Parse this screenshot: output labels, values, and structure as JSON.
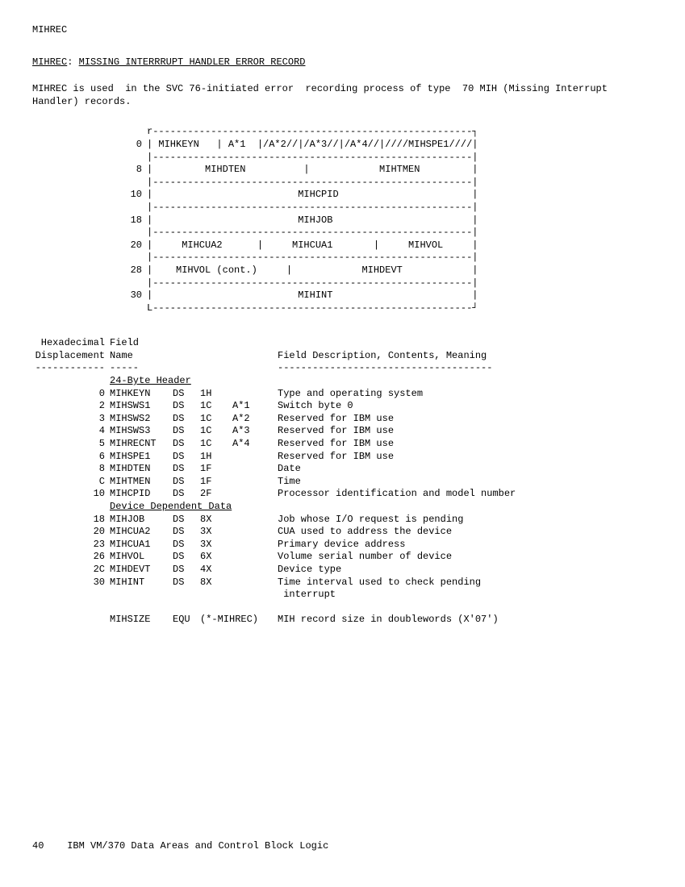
{
  "header_name": "MIHREC",
  "section_title_prefix": "MIHREC",
  "section_title_text": "MISSING INTERRRUPT HANDLER ERROR RECORD",
  "intro": "MIHREC is used  in the SVC 76-initiated error  recording process of type  70 MIH (Missing Interrupt Handler) records.",
  "layout": {
    "rows": [
      {
        "off": "0",
        "line": "| MIHKEYN   | A*1  |/A*2//|/A*3//|/A*4//|////MIHSPE1////|"
      },
      {
        "off": "",
        "line": "|-------------------------------------------------------|"
      },
      {
        "off": "8",
        "line": "|         MIHDTEN          |            MIHTMEN         |"
      },
      {
        "off": "",
        "line": "|-------------------------------------------------------|"
      },
      {
        "off": "10",
        "line": "|                         MIHCPID                       |"
      },
      {
        "off": "",
        "line": "|-------------------------------------------------------|"
      },
      {
        "off": "18",
        "line": "|                         MIHJOB                        |"
      },
      {
        "off": "",
        "line": "|-------------------------------------------------------|"
      },
      {
        "off": "20",
        "line": "|     MIHCUA2      |     MIHCUA1       |     MIHVOL     |"
      },
      {
        "off": "",
        "line": "|-------------------------------------------------------|"
      },
      {
        "off": "28",
        "line": "|    MIHVOL (cont.)     |            MIHDEVT            |"
      },
      {
        "off": "",
        "line": "|-------------------------------------------------------|"
      },
      {
        "off": "30",
        "line": "|                         MIHINT                        |"
      }
    ],
    "top_border": "r-------------------------------------------------------┐",
    "bottom_border": "L-------------------------------------------------------┘"
  },
  "table_headers": {
    "hex1": "Hexadecimal",
    "hex2": "Displacement",
    "hex_dash": "------------",
    "name1": "Field",
    "name2": "Name",
    "name_dash": "-----",
    "desc": "Field Description, Contents, Meaning",
    "desc_dash": "-------------------------------------"
  },
  "section1_title": "24-Byte Header",
  "section2_title": "Device Dependent Data",
  "rows_header": [
    {
      "hex": "0",
      "name": "MIHKEYN",
      "ds": "DS",
      "len": "1H",
      "ref": "",
      "desc": "Type and operating system"
    },
    {
      "hex": "2",
      "name": "MIHSWS1",
      "ds": "DS",
      "len": "1C",
      "ref": "A*1",
      "desc": "Switch byte 0"
    },
    {
      "hex": "3",
      "name": "MIHSWS2",
      "ds": "DS",
      "len": "1C",
      "ref": "A*2",
      "desc": "Reserved for IBM use"
    },
    {
      "hex": "4",
      "name": "MIHSWS3",
      "ds": "DS",
      "len": "1C",
      "ref": "A*3",
      "desc": "Reserved for IBM use"
    },
    {
      "hex": "5",
      "name": "MIHRECNT",
      "ds": "DS",
      "len": "1C",
      "ref": "A*4",
      "desc": "Reserved for IBM use"
    },
    {
      "hex": "6",
      "name": "MIHSPE1",
      "ds": "DS",
      "len": "1H",
      "ref": "",
      "desc": "Reserved for IBM use"
    },
    {
      "hex": "8",
      "name": "MIHDTEN",
      "ds": "DS",
      "len": "1F",
      "ref": "",
      "desc": "Date"
    },
    {
      "hex": "C",
      "name": "MIHTMEN",
      "ds": "DS",
      "len": "1F",
      "ref": "",
      "desc": "Time"
    },
    {
      "hex": "10",
      "name": "MIHCPID",
      "ds": "DS",
      "len": "2F",
      "ref": "",
      "desc": "Processor identification and model number"
    }
  ],
  "rows_device": [
    {
      "hex": "18",
      "name": "MIHJOB",
      "ds": "DS",
      "len": "8X",
      "ref": "",
      "desc": "Job whose I/O request is pending"
    },
    {
      "hex": "20",
      "name": "MIHCUA2",
      "ds": "DS",
      "len": "3X",
      "ref": "",
      "desc": "CUA used to address the device"
    },
    {
      "hex": "23",
      "name": "MIHCUA1",
      "ds": "DS",
      "len": "3X",
      "ref": "",
      "desc": "Primary device address"
    },
    {
      "hex": "26",
      "name": "MIHVOL",
      "ds": "DS",
      "len": "6X",
      "ref": "",
      "desc": "Volume serial number of device"
    },
    {
      "hex": "2C",
      "name": "MIHDEVT",
      "ds": "DS",
      "len": "4X",
      "ref": "",
      "desc": "Device type"
    },
    {
      "hex": "30",
      "name": "MIHINT",
      "ds": "DS",
      "len": "8X",
      "ref": "",
      "desc": "Time interval used to check pending\n interrupt"
    }
  ],
  "trailer": {
    "name": "MIHSIZE",
    "ds": "EQU",
    "len": "(*-MIHREC)",
    "desc": "MIH record size in doublewords (X'07')"
  },
  "footer": {
    "page": "40",
    "text": "IBM VM/370 Data Areas and Control Block Logic"
  }
}
